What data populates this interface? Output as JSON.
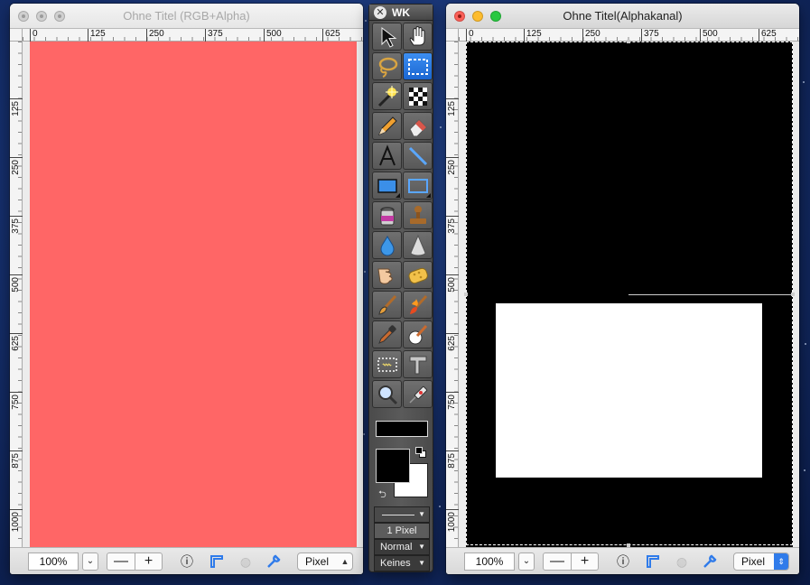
{
  "left_window": {
    "title": "Ohne Titel (RGB+Alpha)",
    "ruler_x": [
      "0",
      "125",
      "250",
      "375",
      "500",
      "625"
    ],
    "ruler_y": [
      "125",
      "250",
      "375",
      "500",
      "625",
      "750",
      "875",
      "1000"
    ],
    "canvas_color": "#ff6666",
    "zoom": "100%",
    "minus": "—",
    "plus": "+",
    "unit": "Pixel"
  },
  "right_window": {
    "title": "Ohne Titel(Alphakanal)",
    "ruler_x": [
      "0",
      "125",
      "250",
      "375",
      "500",
      "625"
    ],
    "ruler_y": [
      "125",
      "250",
      "375",
      "500",
      "625",
      "750",
      "875",
      "1000"
    ],
    "canvas_color": "#000000",
    "mask_color": "#ffffff",
    "zoom": "100%",
    "minus": "—",
    "plus": "+",
    "unit": "Pixel"
  },
  "toolbox": {
    "title": "WK",
    "tools": [
      "arrow-select-icon",
      "hand-icon",
      "lasso-icon",
      "rect-marquee-icon",
      "magic-wand-icon",
      "checker-icon",
      "pencil-icon",
      "eraser-icon",
      "text-tool-icon",
      "line-tool-icon",
      "filled-rect-icon",
      "outline-rect-icon",
      "paint-bucket-icon",
      "stamp-icon",
      "water-drop-icon",
      "cone-icon",
      "smudge-finger-icon",
      "sponge-icon",
      "brush-icon",
      "fire-brush-icon",
      "dropper-icon",
      "clone-brush-icon",
      "marching-rect-icon",
      "clamp-icon",
      "magnifier-icon",
      "syringe-icon"
    ],
    "active_tool": "rect-marquee-icon",
    "line_width": "1 Pixel",
    "blend_mode": "Normal",
    "pattern": "Keines",
    "fg_color": "#000000",
    "bg_color": "#ffffff",
    "accent": "#2f7bea"
  }
}
